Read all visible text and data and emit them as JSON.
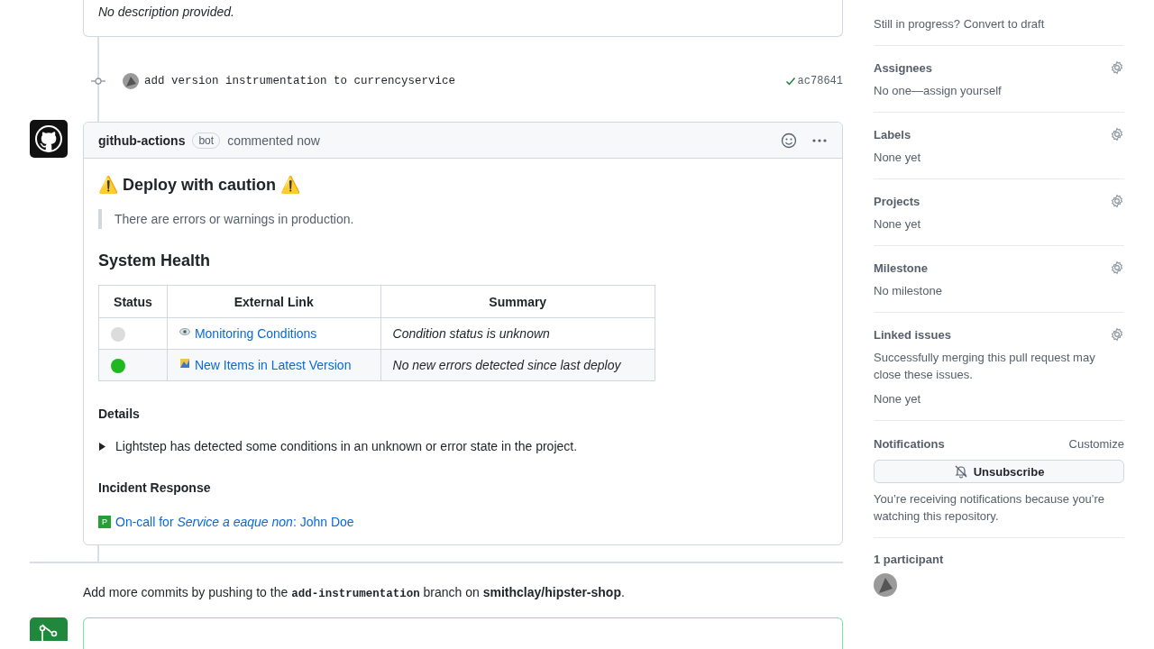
{
  "description": "No description provided.",
  "commit": {
    "message": "add version instrumentation to currencyservice",
    "sha": "ac78641",
    "verified": true
  },
  "comment": {
    "author": "github-actions",
    "badge": "bot",
    "action": "commented now",
    "heading": "⚠️ Deploy with caution ⚠️",
    "quote": "There are errors or warnings in production.",
    "section_title": "System Health",
    "table": {
      "columns": [
        "Status",
        "External Link",
        "Summary"
      ],
      "rows": [
        {
          "color": "#dcdcdc",
          "link": "Monitoring Conditions",
          "summary": "Condition status is unknown"
        },
        {
          "color": "#1fb81f",
          "link": "New Items in Latest Version",
          "summary": "No new errors detected since last deploy"
        }
      ]
    },
    "details": {
      "title": "Details",
      "summary": "Lightstep has detected some conditions in an unknown or error state in the project.",
      "expanded": false
    },
    "incident": {
      "title": "Incident Response",
      "badge": "P",
      "link": "On-call for *Service a eaque non*: John Doe"
    }
  },
  "push_hint": {
    "before": "Add more commits by pushing to the",
    "branch": "add-instrumentation",
    "middle": "branch on",
    "repo": "smithclay/hipster-shop",
    "after": "."
  },
  "sidebar": {
    "draft_hint": "Still in progress? Convert to draft",
    "sections": [
      {
        "title": "Assignees",
        "lines": [
          "No one—assign yourself"
        ]
      },
      {
        "title": "Labels",
        "lines": [
          "None yet"
        ]
      },
      {
        "title": "Projects",
        "lines": [
          "None yet"
        ]
      },
      {
        "title": "Milestone",
        "lines": [
          "No milestone"
        ]
      },
      {
        "title": "Linked issues",
        "lines": [
          "Successfully merging this pull request may close these issues.",
          "None yet"
        ]
      }
    ],
    "notifications": {
      "title": "Notifications",
      "customize": "Customize",
      "button": "Unsubscribe",
      "note": "You’re receiving notifications because you’re watching this repository."
    },
    "participants": {
      "title": "1 participant"
    }
  }
}
